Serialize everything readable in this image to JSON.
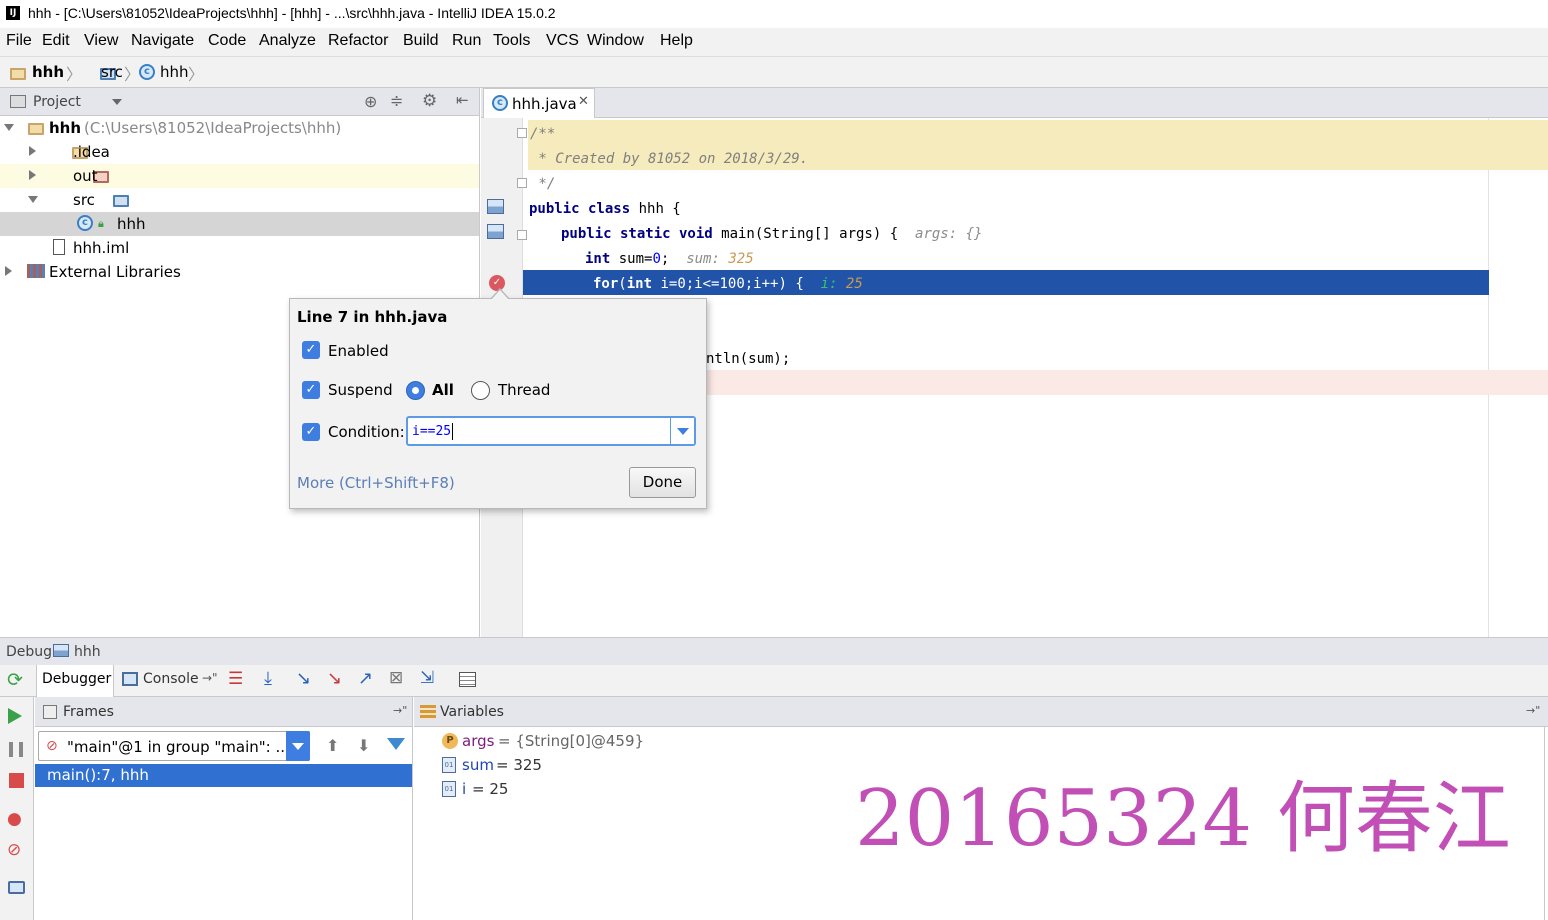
{
  "window": {
    "title": "hhh - [C:\\Users\\81052\\IdeaProjects\\hhh] - [hhh] - ...\\src\\hhh.java - IntelliJ IDEA 15.0.2"
  },
  "menu": [
    "File",
    "Edit",
    "View",
    "Navigate",
    "Code",
    "Analyze",
    "Refactor",
    "Build",
    "Run",
    "Tools",
    "VCS",
    "Window",
    "Help"
  ],
  "breadcrumb": [
    "hhh",
    "src",
    "hhh"
  ],
  "project_panel": {
    "title": "Project",
    "root_name": "hhh",
    "root_path": "(C:\\Users\\81052\\IdeaProjects\\hhh)",
    "items": [
      ".idea",
      "out",
      "src",
      "hhh",
      "hhh.iml",
      "External Libraries"
    ]
  },
  "editor": {
    "tab": "hhh.java",
    "lines": {
      "l1": "/**",
      "l2": " * Created by 81052 on 2018/3/29.",
      "l3": " */",
      "l4_kw": "public class",
      "l4_rest": " hhh {",
      "l5_kw": "public static void",
      "l5_rest": " main(String[] args) {",
      "l5_hint_label": "args:",
      "l5_hint_val": "{}",
      "l6_kw": "int",
      "l6_rest": " sum=",
      "l6_num": "0",
      "l6_semi": ";",
      "l6_hint_label": "sum:",
      "l6_hint_val": "325",
      "l7_kw1": "for",
      "l7_p1": "(",
      "l7_kw2": "int",
      "l7_rest": " i=0;i<=100;i++) {",
      "l7_hint_label": "i:",
      "l7_hint_val": "25",
      "l9_tail": "ntln(sum);"
    }
  },
  "breakpoint_popup": {
    "title": "Line 7 in hhh.java",
    "enabled": "Enabled",
    "suspend": "Suspend",
    "all": "All",
    "thread": "Thread",
    "condition_label": "Condition:",
    "condition_value": "i==25",
    "more": "More (Ctrl+Shift+F8)",
    "done": "Done"
  },
  "debug": {
    "label": "Debug",
    "config": "hhh",
    "tabs": [
      "Debugger",
      "Console"
    ],
    "frames_title": "Frames",
    "thread_select": "\"main\"@1 in group \"main\": ...",
    "frame_item": "main():7, hhh",
    "variables_title": "Variables",
    "variables": [
      {
        "badge": "P",
        "name": "args",
        "value": "= {String[0]@459}"
      },
      {
        "badge": "01",
        "name": "sum",
        "value": "= 325"
      },
      {
        "badge": "01",
        "name": "i",
        "value": "= 25"
      }
    ]
  },
  "watermark": "20165324 何春江",
  "colors": {
    "selection": "#2154a8",
    "breakpoint": "#db5860",
    "watermark": "#c14fb6"
  }
}
